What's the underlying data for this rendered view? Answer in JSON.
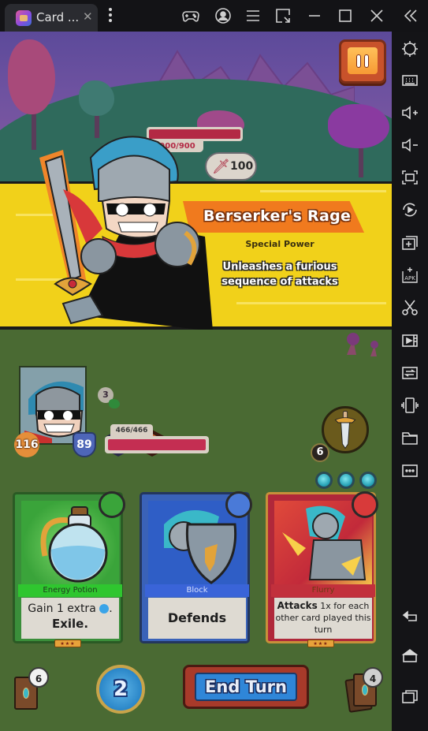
{
  "window": {
    "tab_title": "Card ...",
    "tab_close": "✕",
    "titlebar_icons": [
      "gamepad-icon",
      "account-icon",
      "menu-icon",
      "window-resize-icon",
      "minimize-icon",
      "maximize-icon",
      "close-icon",
      "collapse-sidebar-icon"
    ]
  },
  "game": {
    "enemy": {
      "hp_text": "900/900",
      "hp_fraction": 1.0,
      "attack_value": "100"
    },
    "pause_button": "pause",
    "special_power": {
      "title": "Berserker's Rage",
      "subtitle": "Special Power",
      "description": "Unleashes a furious sequence of attacks"
    },
    "player": {
      "hp_text": "466/466",
      "hp_fraction": 1.0,
      "health_badge": "116",
      "armor_badge": "89",
      "stack_count": "3",
      "buffs": [
        "shield-buff-icon",
        "fire-buff-icon"
      ]
    },
    "weapon": {
      "charge_count": "6",
      "orbs": 3
    },
    "cards": [
      {
        "name": "Energy Potion",
        "text_line1": "Gain 1 extra",
        "text_line2": "Exile.",
        "type_icon": "energy-type-icon",
        "rarity": "★★★",
        "color": "#3a8e3a"
      },
      {
        "name": "Block",
        "text_line1": "Defends",
        "type_icon": "defense-type-icon",
        "color": "#3a62b8"
      },
      {
        "name": "Flurry",
        "text_bold": "Attacks",
        "text_rest": " 1x for each other card played this turn",
        "type_icon": "attack-type-icon",
        "rarity": "★★★",
        "color": "#b0283a"
      }
    ],
    "draw_pile_count": "6",
    "energy": "2",
    "end_turn_label": "End Turn",
    "discard_pile_count": "4"
  },
  "sidebar": {
    "tools": [
      "settings-icon",
      "keyboard-icon",
      "volume-up-icon",
      "volume-down-icon",
      "screenshot-region-icon",
      "rotate-play-icon",
      "add-window-icon",
      "install-apk-icon",
      "scissors-icon",
      "record-video-icon",
      "sync-icon",
      "shake-icon",
      "folder-icon",
      "more-icon"
    ],
    "nav": [
      "back-icon",
      "home-icon",
      "recent-apps-icon"
    ]
  }
}
